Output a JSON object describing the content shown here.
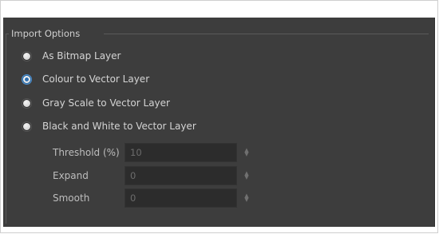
{
  "import_options": {
    "title": "Import Options",
    "options": [
      {
        "label": "As Bitmap Layer",
        "checked": false
      },
      {
        "label": "Colour to Vector Layer",
        "checked": true
      },
      {
        "label": "Gray Scale to Vector Layer",
        "checked": false
      },
      {
        "label": "Black and White to Vector Layer",
        "checked": false
      }
    ],
    "fields": [
      {
        "label": "Threshold (%)",
        "value": "10",
        "enabled": false
      },
      {
        "label": "Expand",
        "value": "0",
        "enabled": false
      },
      {
        "label": "Smooth",
        "value": "0",
        "enabled": false
      }
    ]
  },
  "icons": {
    "stepper": "spin-arrows-icon"
  },
  "colors": {
    "panel_bg": "#3d3d3d",
    "selected_radio": "#2e6fb0",
    "text": "#d4d4d4"
  }
}
